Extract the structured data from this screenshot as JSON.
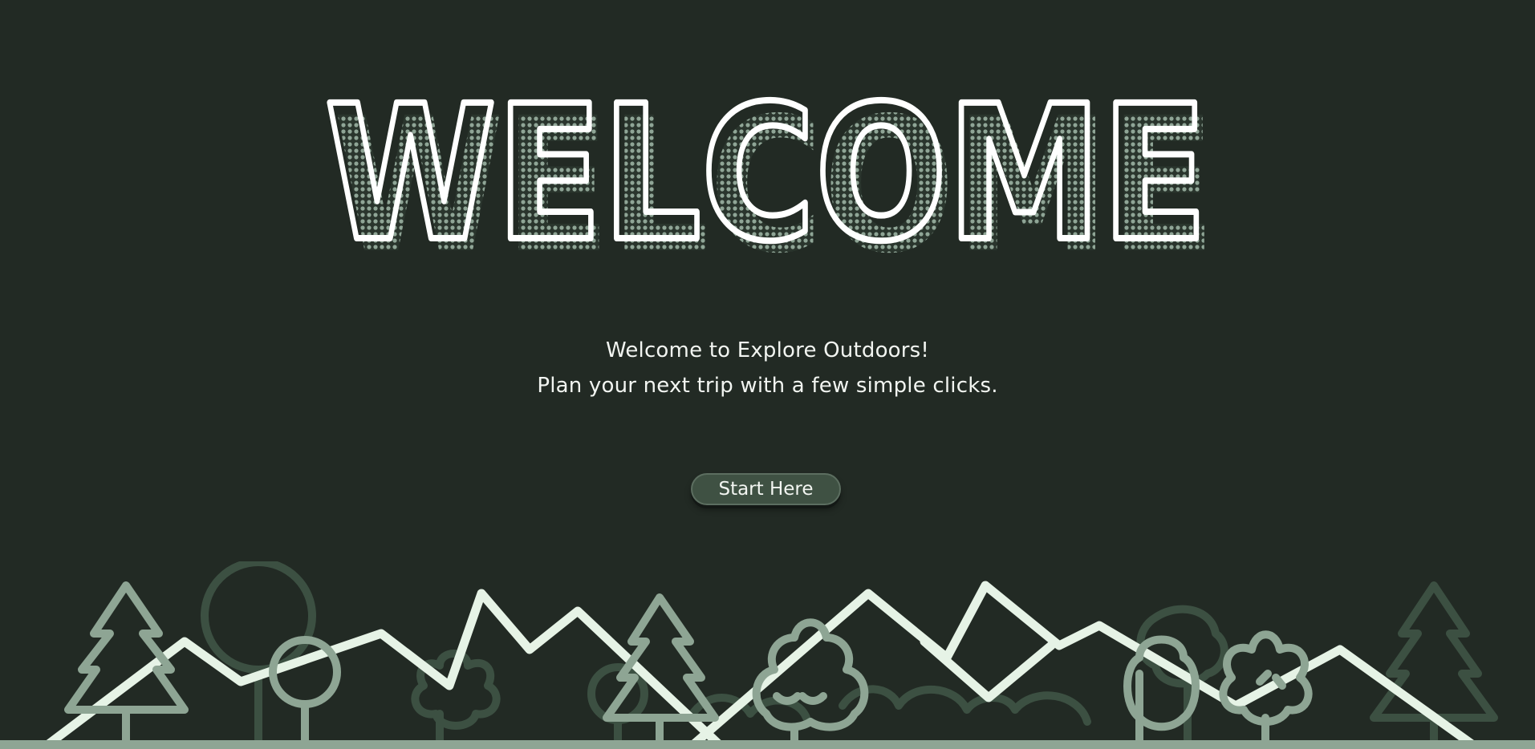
{
  "hero": {
    "title": "WELCOME"
  },
  "intro": {
    "line1": "Welcome to Explore Outdoors!",
    "line2": "Plan your next trip with a few simple clicks."
  },
  "cta": {
    "label": "Start Here"
  },
  "colors": {
    "background": "#222a24",
    "title_outline": "#ffffff",
    "title_shadow": "#8fa596",
    "button_bg": "#3f5143",
    "mountain_light": "#e6f3e6",
    "tree_mid": "#8ea594",
    "tree_dark": "#3c5042"
  },
  "icons": {
    "scenery": "forest-mountains-illustration"
  }
}
